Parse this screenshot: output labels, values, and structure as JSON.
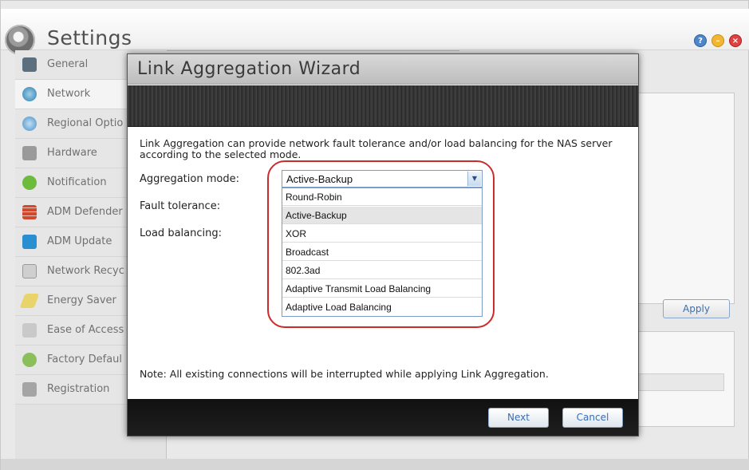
{
  "app": {
    "title": "Settings",
    "icon": "gear-icon"
  },
  "window_buttons": {
    "help": "?",
    "minimize": "–",
    "close": "×"
  },
  "sidebar": {
    "items": [
      {
        "label": "General",
        "icon": "general-icon"
      },
      {
        "label": "Network",
        "icon": "network-icon"
      },
      {
        "label": "Regional Optio",
        "icon": "globe-icon"
      },
      {
        "label": "Hardware",
        "icon": "hardware-icon"
      },
      {
        "label": "Notification",
        "icon": "notification-icon"
      },
      {
        "label": "ADM Defender",
        "icon": "firewall-icon"
      },
      {
        "label": "ADM Update",
        "icon": "update-icon"
      },
      {
        "label": "Network Recyc",
        "icon": "recycle-bin-icon"
      },
      {
        "label": "Energy Saver",
        "icon": "energy-icon"
      },
      {
        "label": "Ease of Access",
        "icon": "access-icon"
      },
      {
        "label": "Factory Defaul",
        "icon": "factory-reset-icon"
      },
      {
        "label": "Registration",
        "icon": "registration-icon"
      }
    ],
    "active_index": 1
  },
  "background": {
    "apply_label": "Apply"
  },
  "dialog": {
    "title": "Link Aggregation Wizard",
    "description": "Link Aggregation can provide network fault tolerance and/or load balancing for the NAS server according to the selected mode.",
    "fields": {
      "aggregation_mode_label": "Aggregation mode:",
      "fault_tolerance_label": "Fault tolerance:",
      "load_balancing_label": "Load balancing:"
    },
    "select": {
      "value": "Active-Backup",
      "options": [
        "Round-Robin",
        "Active-Backup",
        "XOR",
        "Broadcast",
        "802.3ad",
        "Adaptive Transmit Load Balancing",
        "Adaptive Load Balancing"
      ],
      "selected_index": 1
    },
    "note": "Note: All existing connections will be interrupted while applying Link Aggregation.",
    "buttons": {
      "next": "Next",
      "cancel": "Cancel"
    }
  },
  "colors": {
    "highlight_ring": "#cc2b2b",
    "accent_text": "#3b6fb0"
  }
}
